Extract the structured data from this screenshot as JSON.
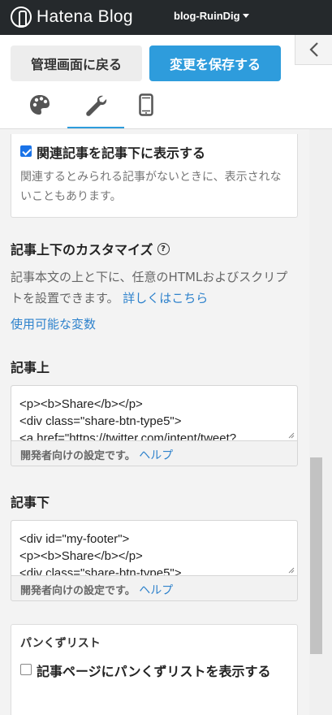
{
  "topbar": {
    "logo_text": "Hatena Blog",
    "blog_name": "blog-RuinDig",
    "background": "#25292c"
  },
  "header": {
    "back_label": "管理画面に戻る",
    "save_label": "変更を保存する",
    "accent": "#2e9cdc"
  },
  "tabs": [
    {
      "icon": "palette-icon",
      "active": false
    },
    {
      "icon": "wrench-icon",
      "active": true
    },
    {
      "icon": "smartphone-icon",
      "active": false
    }
  ],
  "related": {
    "checkbox_label": "関連記事を記事下に表示する",
    "checked": true,
    "description": "関連するとみられる記事がないときに、表示されないこともあります。"
  },
  "customize": {
    "title": "記事上下のカスタマイズ",
    "description": "記事本文の上と下に、任意のHTMLおよびスクリプトを設置できます。",
    "more_link": "詳しくはこちら",
    "variables_link": "使用可能な変数"
  },
  "above": {
    "title": "記事上",
    "code": "<p><b>Share</b></p>\n<div class=\"share-btn-type5\">\n<a href=\"https://twitter.com/intent/tweet?",
    "foot_text": "開発者向けの設定です。",
    "foot_link": "ヘルプ"
  },
  "below": {
    "title": "記事下",
    "code": "<div id=\"my-footer\">\n<p><b>Share</b></p>\n<div class=\"share-btn-type5\">",
    "foot_text": "開発者向けの設定です。",
    "foot_link": "ヘルプ"
  },
  "breadcrumb": {
    "title": "パンくずリスト",
    "checkbox_label": "記事ページにパンくずリストを表示する",
    "checked": false
  }
}
